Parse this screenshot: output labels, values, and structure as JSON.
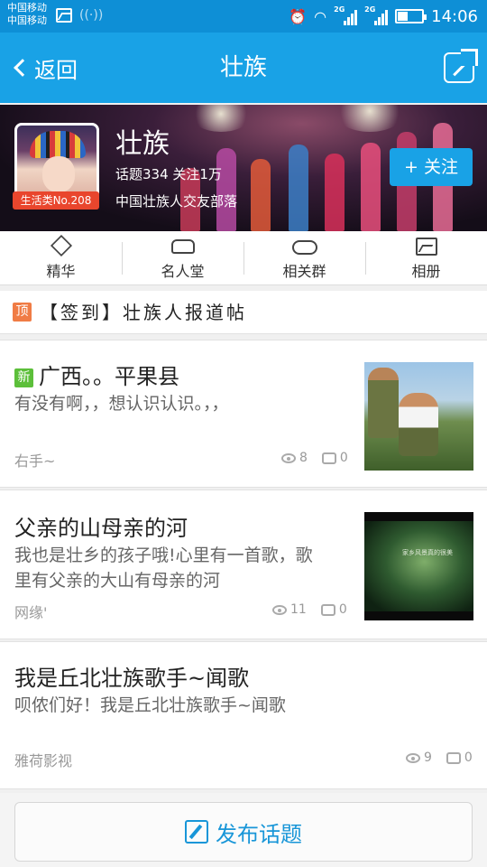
{
  "status_bar": {
    "carrier_line1": "中国移动",
    "carrier_line2": "中国移动",
    "time": "14:06",
    "signal_tag1": "2G",
    "signal_tag2": "2G"
  },
  "nav": {
    "back_label": "返回",
    "title": "壮族"
  },
  "group": {
    "name": "壮族",
    "stats": "话题334 关注1万",
    "description": "中国壮族人交友部落",
    "level_badge": "生活类No.208",
    "follow_label": "+ 关注"
  },
  "tabs": [
    {
      "label": "精华",
      "icon": "diamond-icon"
    },
    {
      "label": "名人堂",
      "icon": "sofa-icon"
    },
    {
      "label": "相关群",
      "icon": "group-cloud-icon"
    },
    {
      "label": "相册",
      "icon": "picture-icon"
    }
  ],
  "pinned": {
    "badge": "顶",
    "title": "【签到】壮族人报道帖"
  },
  "posts": [
    {
      "badge": "新",
      "title": "广西。。平果县",
      "summary": "有没有啊，，想认识认识。，，",
      "author": "右手~",
      "views": "8",
      "comments": "0"
    },
    {
      "title": "父亲的山母亲的河",
      "summary_line1": "我也是壮乡的孩子哦!心里有一首歌，歌",
      "summary_line2": "里有父亲的大山有母亲的河",
      "author": "网缘'",
      "views": "11",
      "comments": "0",
      "thumb_caption": "家乡风景真的很美"
    },
    {
      "title": "我是丘北壮族歌手~闻歌",
      "summary": "呗侬们好！我是丘北壮族歌手~闻歌",
      "author": "雅荷影视",
      "views": "9",
      "comments": "0"
    }
  ],
  "publish_button": {
    "label": "发布话题"
  },
  "colors": {
    "accent": "#19a2e6",
    "status_bar": "#0e8fd6",
    "level_badge": "#e9462d",
    "pin_badge": "#f07c45",
    "new_badge": "#5cbf3a"
  }
}
